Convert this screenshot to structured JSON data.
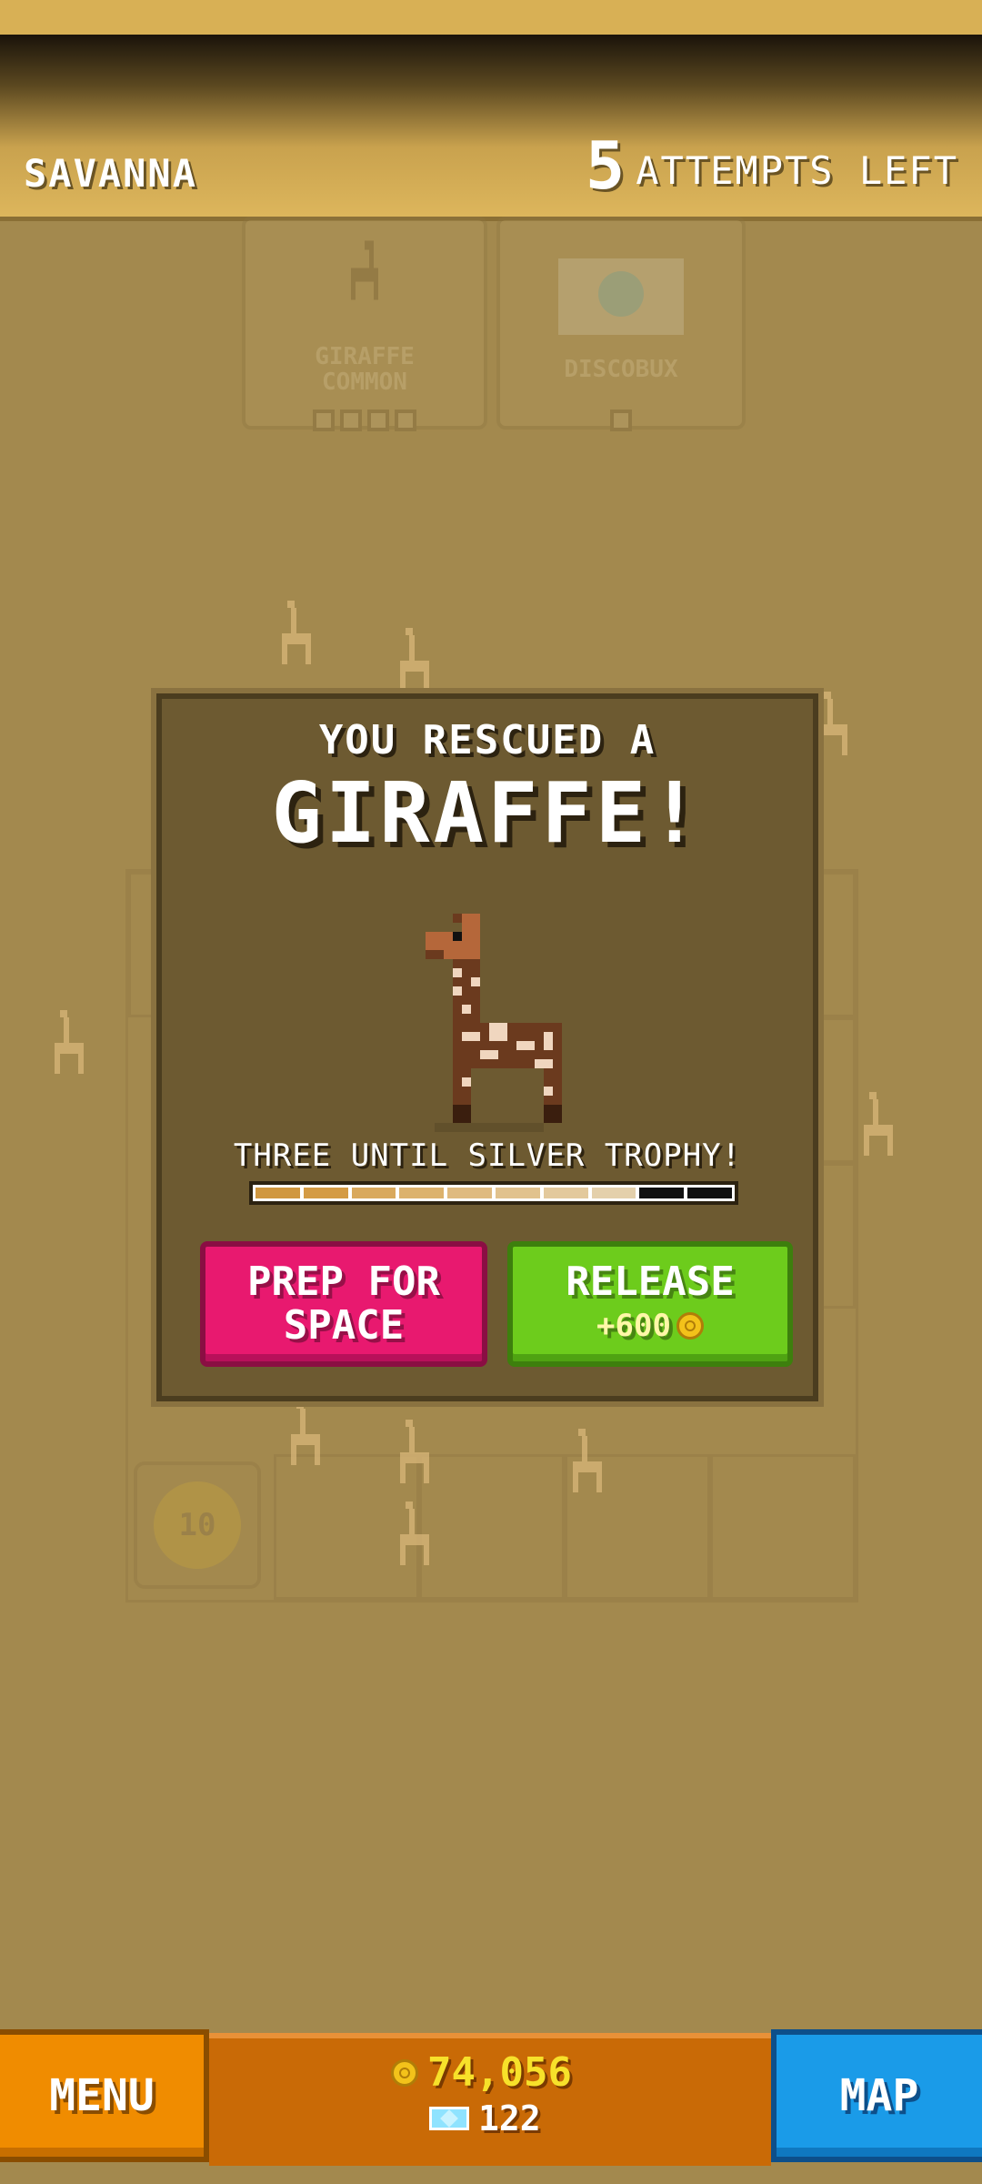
{
  "header": {
    "level_name": "SAVANNA",
    "attempts_number": "5",
    "attempts_text": "ATTEMPTS LEFT"
  },
  "background_board": {
    "cards": [
      {
        "label_1": "GIRAFFE",
        "label_2": "COMMON",
        "progress_boxes": 4
      },
      {
        "label_1": "DISCOBUX",
        "label_2": "",
        "progress_boxes": 1
      }
    ],
    "bonus_tile_value": "10"
  },
  "modal": {
    "heading": "YOU RESCUED A",
    "animal_name": "GIRAFFE!",
    "trophy_message": "THREE UNTIL SILVER TROPHY!",
    "trophy_progress": {
      "segments_total": 10,
      "segments_filled": 8,
      "segment_colors": [
        "#d0973f",
        "#d49b44",
        "#d9a95d",
        "#dcb26d",
        "#dfba7f",
        "#e1c28d",
        "#e3c99c",
        "#e4d0ab",
        "#111111",
        "#111111"
      ]
    },
    "buttons": {
      "prep_label_1": "PREP FOR",
      "prep_label_2": "SPACE",
      "release_label": "RELEASE",
      "release_reward": "+600"
    }
  },
  "bottom_bar": {
    "menu_label": "MENU",
    "coins": "74,056",
    "gems": "122",
    "map_label": "MAP"
  },
  "colors": {
    "background": "#a3894e",
    "prep_button": "#e8196f",
    "release_button": "#6dcc1c",
    "menu_button": "#f08c00",
    "map_button": "#1a9be8",
    "coin_text": "#f7e12a"
  }
}
